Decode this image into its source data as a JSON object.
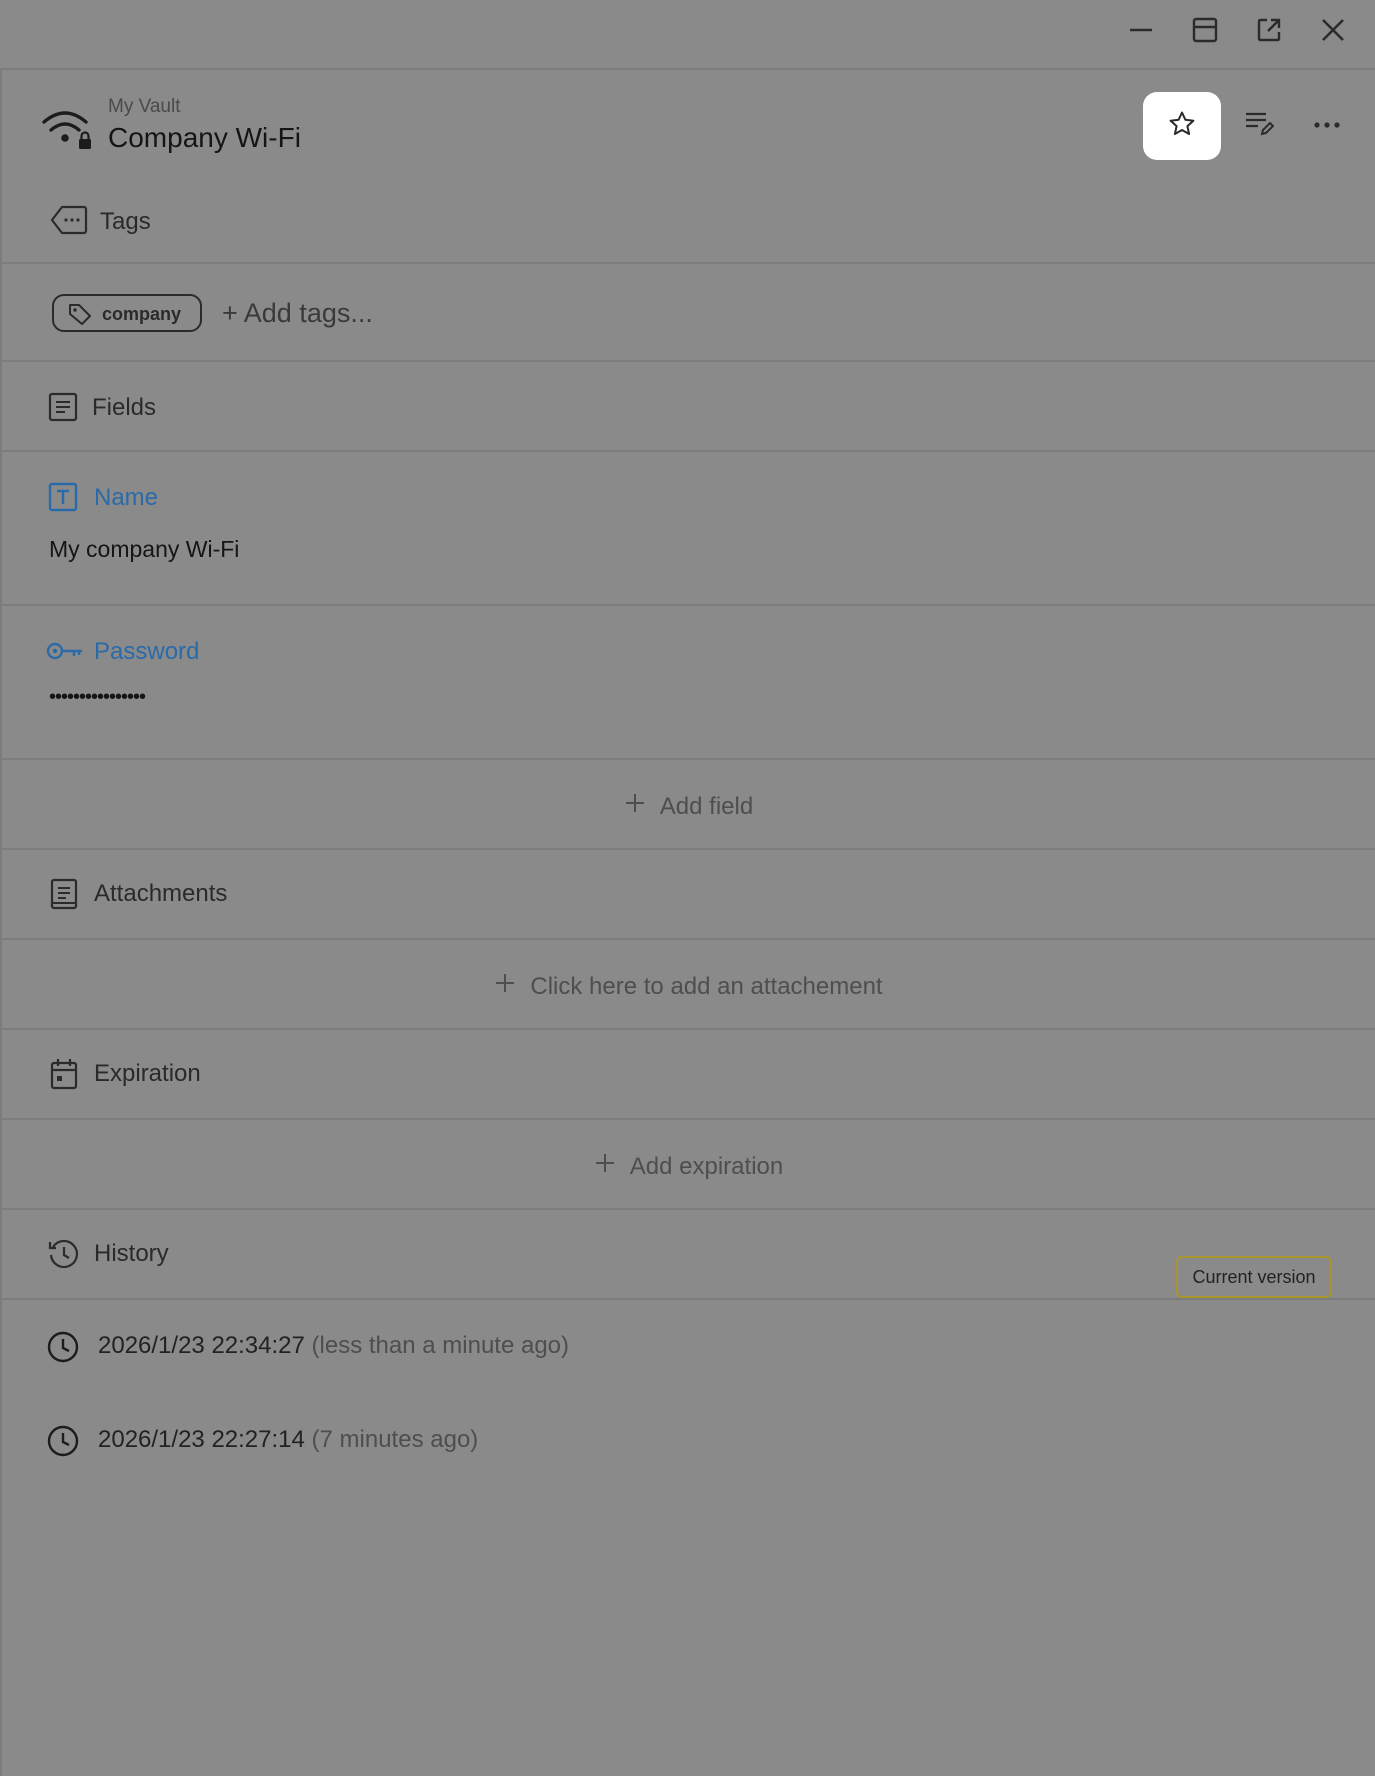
{
  "window": {
    "minimize_icon": "minimize-icon",
    "maximize_icon": "maximize-icon",
    "popout_icon": "open-external-icon",
    "close_icon": "close-icon"
  },
  "header": {
    "vault": "My Vault",
    "title": "Company Wi-Fi",
    "item_icon": "wifi-lock-icon",
    "actions": [
      "star-icon",
      "edit-list-icon",
      "more-icon"
    ]
  },
  "tags": {
    "section_label": "Tags",
    "items": [
      "company"
    ],
    "add_label": "+ Add tags..."
  },
  "fields": {
    "section_label": "Fields",
    "items": [
      {
        "label": "Name",
        "value": "My company Wi-Fi",
        "icon": "text-field-icon"
      },
      {
        "label": "Password",
        "value": "••••••••••••••••",
        "icon": "key-icon"
      }
    ],
    "add_label": "Add field"
  },
  "attachments": {
    "section_label": "Attachments",
    "add_label": "Click here to add an attachement"
  },
  "expiration": {
    "section_label": "Expiration",
    "add_label": "Add expiration"
  },
  "history": {
    "section_label": "History",
    "entries": [
      {
        "date": "2026/1/23 22:34:27",
        "relative": "(less than a minute ago)",
        "badge": "Current version"
      },
      {
        "date": "2026/1/23 22:27:14",
        "relative": "(7 minutes ago)"
      }
    ]
  },
  "colors": {
    "overlay": "#8a8a8a",
    "field_label": "#2a6aa8",
    "badge_border": "#a9942e"
  }
}
